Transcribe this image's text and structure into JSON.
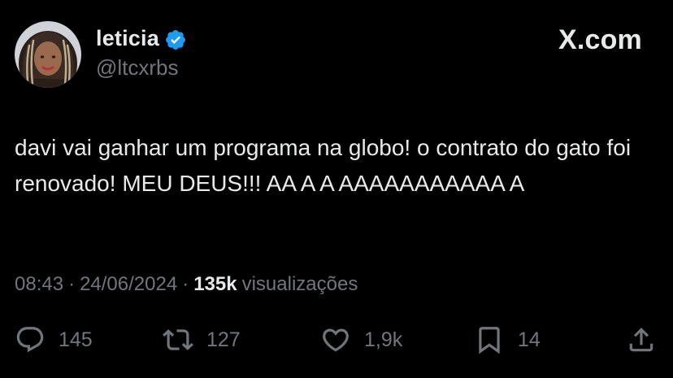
{
  "author": {
    "display_name": "leticia",
    "handle": "@ltcxrbs",
    "verified": true
  },
  "brand": {
    "domain": "X.com",
    "logo_icon": "x-logo-icon"
  },
  "tweet": {
    "text": "davi vai ganhar um programa na globo! o contrato do gato foi renovado! MEU DEUS!!! AA A A AAAAAAAAAAA A"
  },
  "meta": {
    "time": "08:43",
    "separator": "·",
    "date": "24/06/2024",
    "views_count": "135k",
    "views_label": "visualizações"
  },
  "actions": {
    "replies": {
      "icon": "reply-icon",
      "count": "145"
    },
    "reposts": {
      "icon": "repost-icon",
      "count": "127"
    },
    "likes": {
      "icon": "heart-icon",
      "count": "1,9k"
    },
    "bookmarks": {
      "icon": "bookmark-icon",
      "count": "14"
    },
    "share": {
      "icon": "share-icon"
    }
  },
  "colors": {
    "background": "#000000",
    "text_primary": "#e7e9ea",
    "text_secondary": "#71767b",
    "verified_blue": "#1d9bf0"
  }
}
